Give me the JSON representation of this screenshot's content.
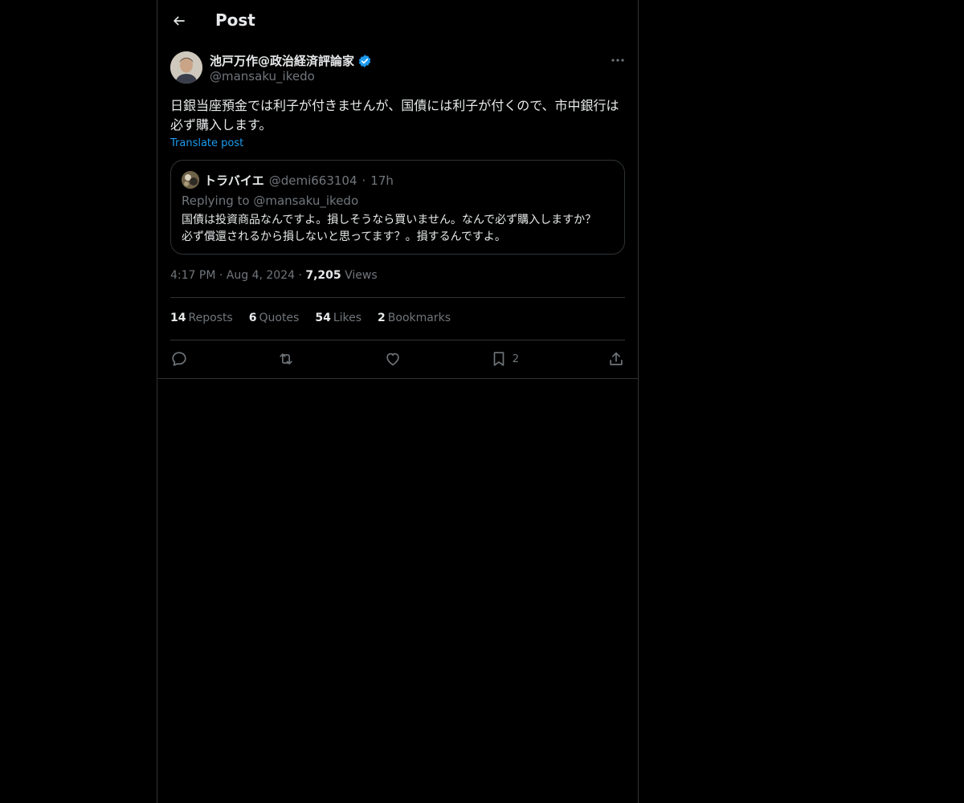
{
  "header": {
    "title": "Post"
  },
  "post": {
    "author_name": "池戸万作@政治経済評論家",
    "author_handle": "@mansaku_ikedo",
    "text": "日銀当座預金では利子が付きませんが、国債には利子が付くので、市中銀行は必ず購入します。",
    "translate_label": "Translate post",
    "time": "4:17 PM",
    "date": "Aug 4, 2024",
    "views_count": "7,205",
    "views_label": "Views"
  },
  "quote": {
    "author_name": "トラバイエ",
    "author_handle": "@demi663104",
    "age": "17h",
    "replying_to": "Replying to @mansaku_ikedo",
    "text": "国債は投資商品なんですよ。損しそうなら買いません。なんで必ず購入しますか？必ず償還されるから損しないと思ってます？。損するんですよ。"
  },
  "stats": {
    "reposts_count": "14",
    "reposts_label": "Reposts",
    "quotes_count": "6",
    "quotes_label": "Quotes",
    "likes_count": "54",
    "likes_label": "Likes",
    "bookmarks_count": "2",
    "bookmarks_label": "Bookmarks"
  },
  "actions": {
    "bookmark_count": "2"
  },
  "icons": [
    "back-arrow-icon",
    "verified-badge-icon",
    "more-icon",
    "reply-icon",
    "repost-icon",
    "like-icon",
    "bookmark-icon",
    "share-icon"
  ],
  "colors": {
    "background": "#000000",
    "text": "#e7e9ea",
    "muted": "#71767b",
    "accent": "#1d9bf0",
    "border": "#2f3336"
  }
}
